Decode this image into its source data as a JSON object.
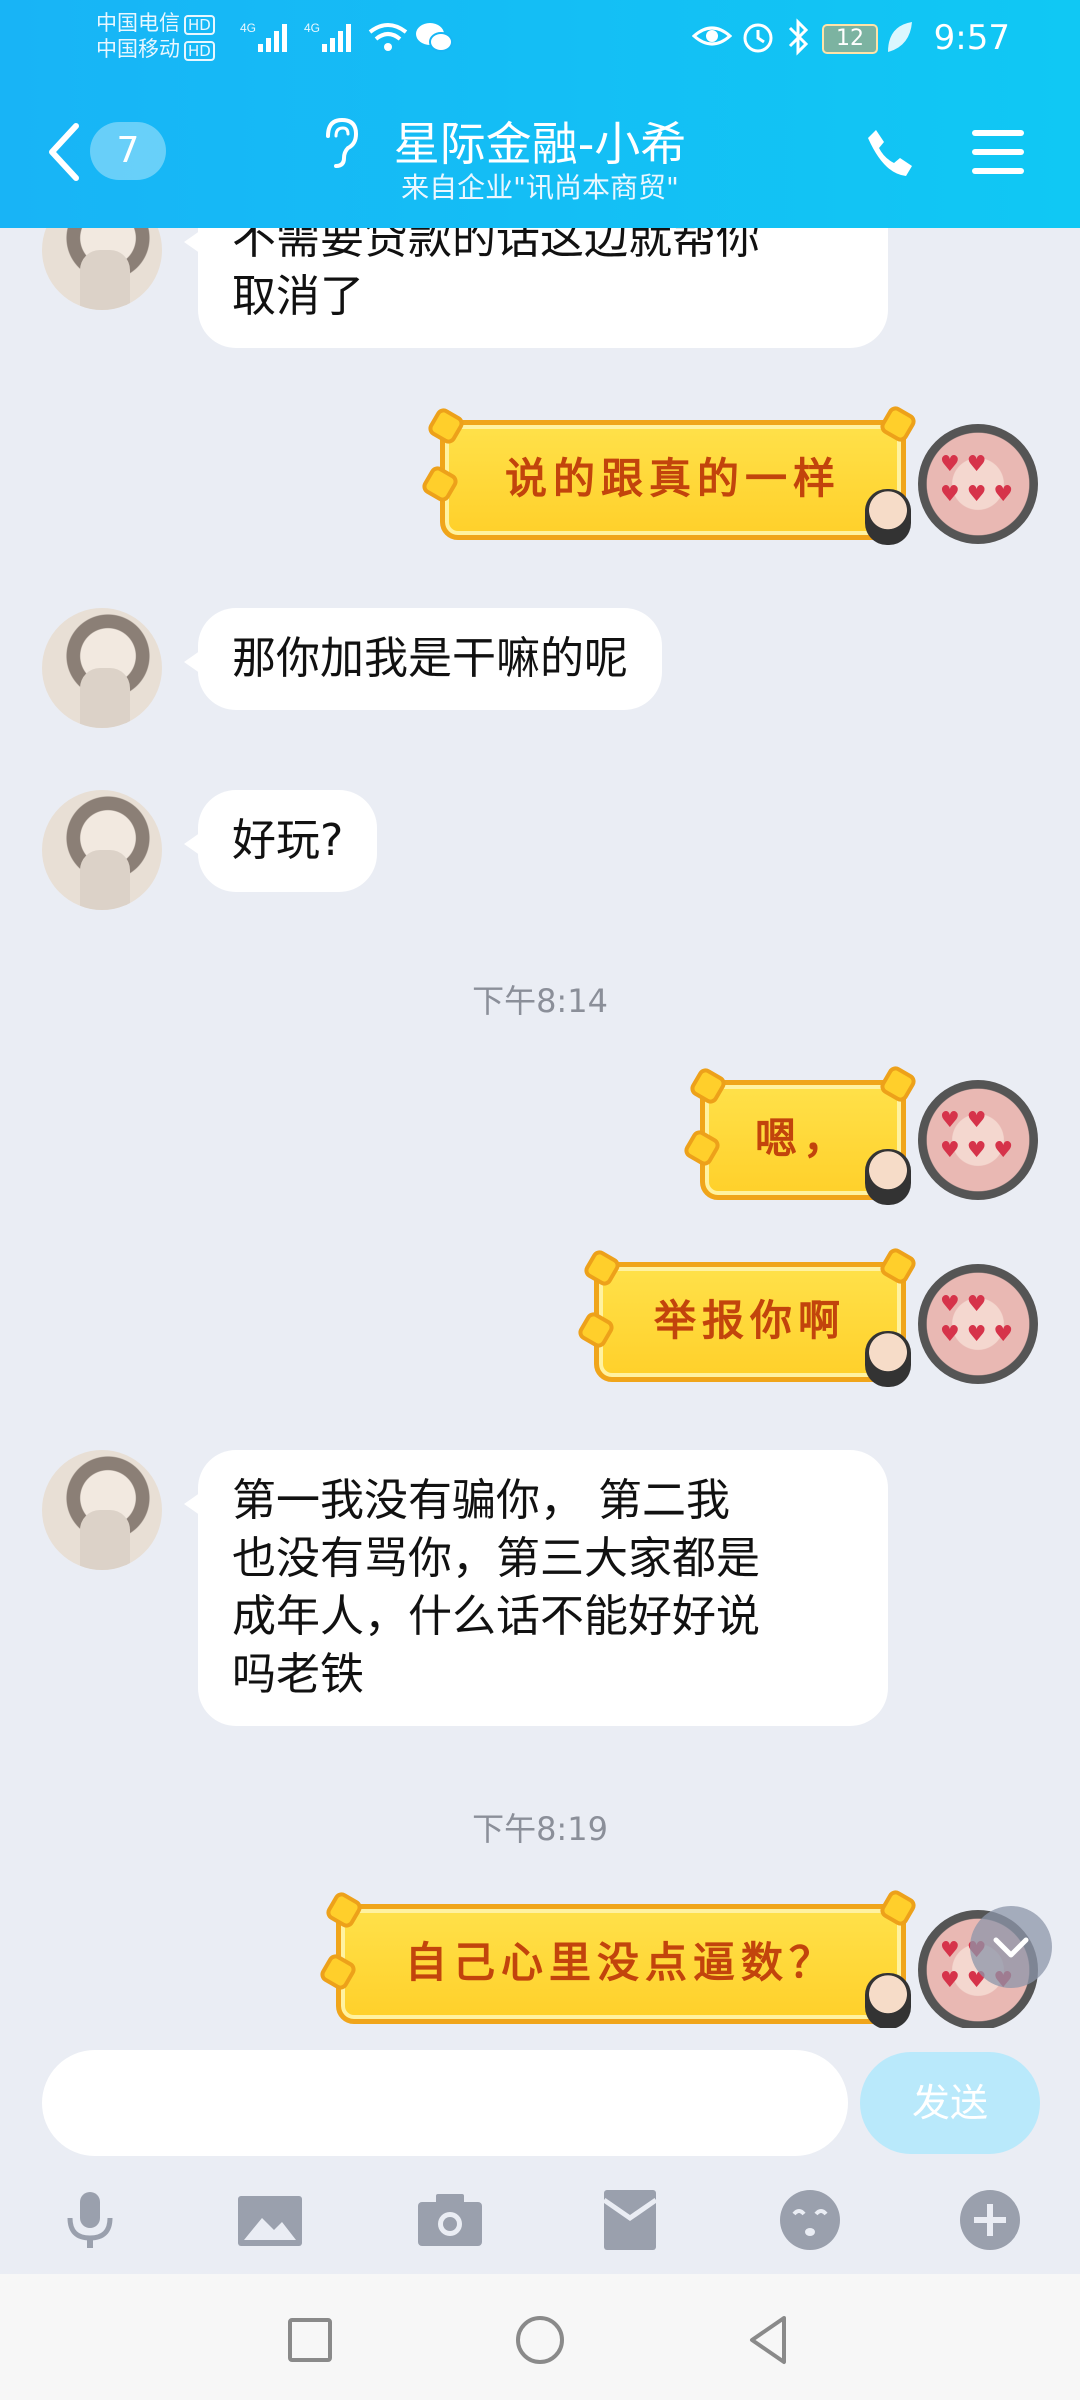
{
  "status_bar": {
    "carrier1": "中国电信",
    "carrier2": "中国移动",
    "hd": "HD",
    "net1": "4G",
    "net2": "4G",
    "battery": "12",
    "time": "9:57"
  },
  "header": {
    "unread_count": "7",
    "title": "星际金融-小希",
    "subtitle": "来自企业\"讯尚本商贸\""
  },
  "messages": [
    {
      "type": "text",
      "from": "other",
      "text": "不需要贷款的话这边就帮你\n取消了"
    },
    {
      "type": "sticker",
      "from": "me",
      "text": "说的跟真的一样"
    },
    {
      "type": "text",
      "from": "other",
      "text": "那你加我是干嘛的呢"
    },
    {
      "type": "text",
      "from": "other",
      "text": "好玩?"
    },
    {
      "type": "time",
      "text": "下午8:14"
    },
    {
      "type": "sticker",
      "from": "me",
      "text": "嗯，"
    },
    {
      "type": "sticker",
      "from": "me",
      "text": "举报你啊"
    },
    {
      "type": "text",
      "from": "other",
      "text": "第一我没有骗你， 第二我\n也没有骂你，第三大家都是\n成年人，什么话不能好好说\n吗老铁"
    },
    {
      "type": "time",
      "text": "下午8:19"
    },
    {
      "type": "sticker",
      "from": "me",
      "text": "自己心里没点逼数？"
    }
  ],
  "composer": {
    "input_value": "",
    "send_label": "发送"
  },
  "toolbar_icons": [
    "microphone-icon",
    "image-icon",
    "camera-icon",
    "red-packet-icon",
    "emoji-icon",
    "plus-icon"
  ],
  "colors": {
    "header": "#18b4f6",
    "chat_bg": "#eaedf4",
    "send_disabled": "#b9e9fb",
    "sticker": "#ffd02a"
  }
}
